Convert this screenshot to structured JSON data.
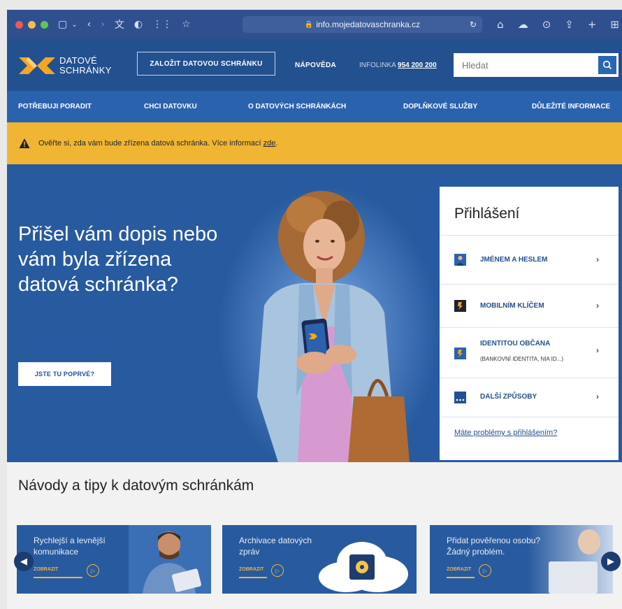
{
  "browser": {
    "url": "info.mojedatovaschranka.cz",
    "traffic_colors": [
      "#ee5a52",
      "#f3be4f",
      "#5fc656"
    ]
  },
  "header": {
    "logo_line1": "DATOVÉ",
    "logo_line2": "SCHRÁNKY",
    "create_button": "ZALOŽIT DATOVOU SCHRÁNKU",
    "help_link": "NÁPOVĚDA",
    "infoline_label": "INFOLINKA",
    "infoline_number": "954 200 200",
    "search_placeholder": "Hledat"
  },
  "nav": {
    "items": [
      "POTŘEBUJI PORADIT",
      "CHCI DATOVKU",
      "O DATOVÝCH SCHRÁNKÁCH",
      "DOPLŇKOVÉ SLUŽBY",
      "DŮLEŽITÉ INFORMACE"
    ]
  },
  "notice": {
    "text": "Ověřte si, zda vám bude zřízena datová schránka. Více informací",
    "link": "zde",
    "end": "."
  },
  "hero": {
    "title": "Přišel vám dopis nebo vám byla zřízena datová schránka?",
    "button": "JSTE TU POPRVÉ?"
  },
  "login": {
    "title": "Přihlášení",
    "options": [
      {
        "label": "JMÉNEM A HESLEM",
        "sub": "",
        "icon": "person-icon"
      },
      {
        "label": "MOBILNÍM KLÍČEM",
        "sub": "",
        "icon": "mobile-key-icon"
      },
      {
        "label": "IDENTITOU OBČANA",
        "sub": "(BANKOVNÍ IDENTITA, NIA ID...)",
        "icon": "citizen-identity-icon"
      },
      {
        "label": "DALŠÍ ZPŮSOBY",
        "sub": "",
        "icon": "more-icon"
      }
    ],
    "problem_link": "Máte problémy s přihlášením?"
  },
  "guides": {
    "title": "Návody a tipy k datovým schránkám",
    "cards": [
      {
        "title_line1": "Rychlejší a levnější",
        "title_line2": "komunikace",
        "link": "ZOBRAZIT"
      },
      {
        "title_line1": "Archivace datových",
        "title_line2": "zpráv",
        "link": "ZOBRAZIT"
      },
      {
        "title_line1": "Přidat pověřenou osobu?",
        "title_line2": "Žádný problém.",
        "link": "ZOBRAZIT"
      }
    ]
  },
  "colors": {
    "header_blue": "#23508f",
    "nav_blue": "#2b62ad",
    "notice_yellow": "#f0b533",
    "hero_blue": "#285a9f",
    "logo_orange": "#f5a623"
  }
}
